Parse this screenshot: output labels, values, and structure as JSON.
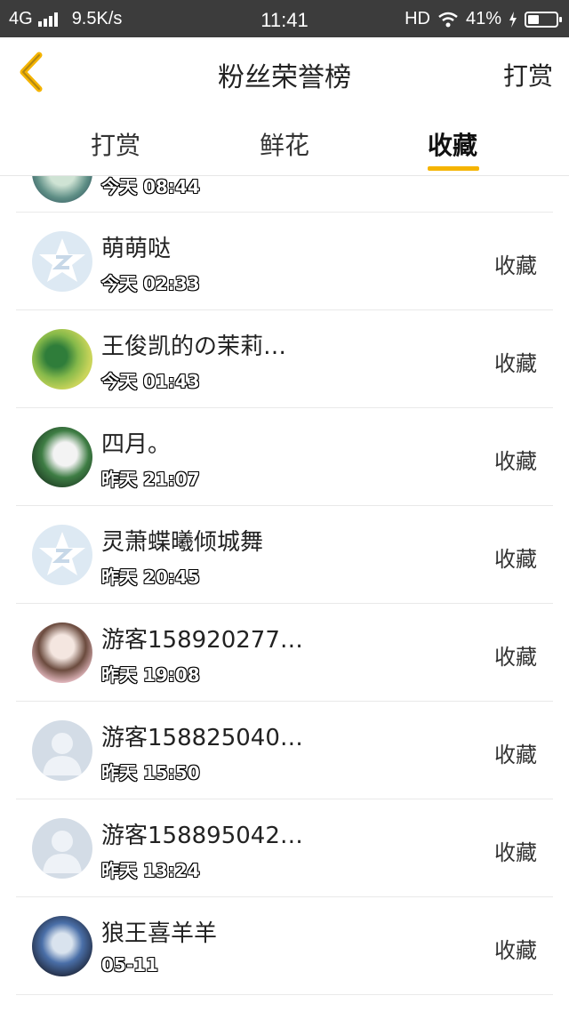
{
  "status_bar": {
    "network": "4G",
    "speed": "9.5K/s",
    "time": "11:41",
    "hd": "HD",
    "battery": "41%",
    "battery_level": 0.41
  },
  "header": {
    "title": "粉丝荣誉榜",
    "right_action": "打赏",
    "back_icon": "chevron-left-icon",
    "accent_color": "#f5b400"
  },
  "tabs": [
    {
      "label": "打赏",
      "active": false
    },
    {
      "label": "鲜花",
      "active": false
    },
    {
      "label": "收藏",
      "active": true
    }
  ],
  "list": {
    "partial_row": {
      "time": "今天 08:44"
    },
    "rows": [
      {
        "name": "萌萌哒",
        "time": "今天 02:33",
        "action": "收藏",
        "avatar": "default-q-avatar"
      },
      {
        "name": "王俊凯的の茉莉…",
        "time": "今天 01:43",
        "action": "收藏",
        "avatar": "photo-avatar"
      },
      {
        "name": "四月。",
        "time": "昨天 21:07",
        "action": "收藏",
        "avatar": "anime-avatar"
      },
      {
        "name": "灵萧蝶曦倾城舞",
        "time": "昨天 20:45",
        "action": "收藏",
        "avatar": "default-q-avatar"
      },
      {
        "name": "游客158920277…",
        "time": "昨天 19:08",
        "action": "收藏",
        "avatar": "anime-avatar"
      },
      {
        "name": "游客158825040…",
        "time": "昨天 15:50",
        "action": "收藏",
        "avatar": "default-person-avatar"
      },
      {
        "name": "游客158895042…",
        "time": "昨天 13:24",
        "action": "收藏",
        "avatar": "default-person-avatar"
      },
      {
        "name": "狼王喜羊羊",
        "time": "05-11",
        "action": "收藏",
        "avatar": "cartoon-avatar"
      }
    ]
  }
}
